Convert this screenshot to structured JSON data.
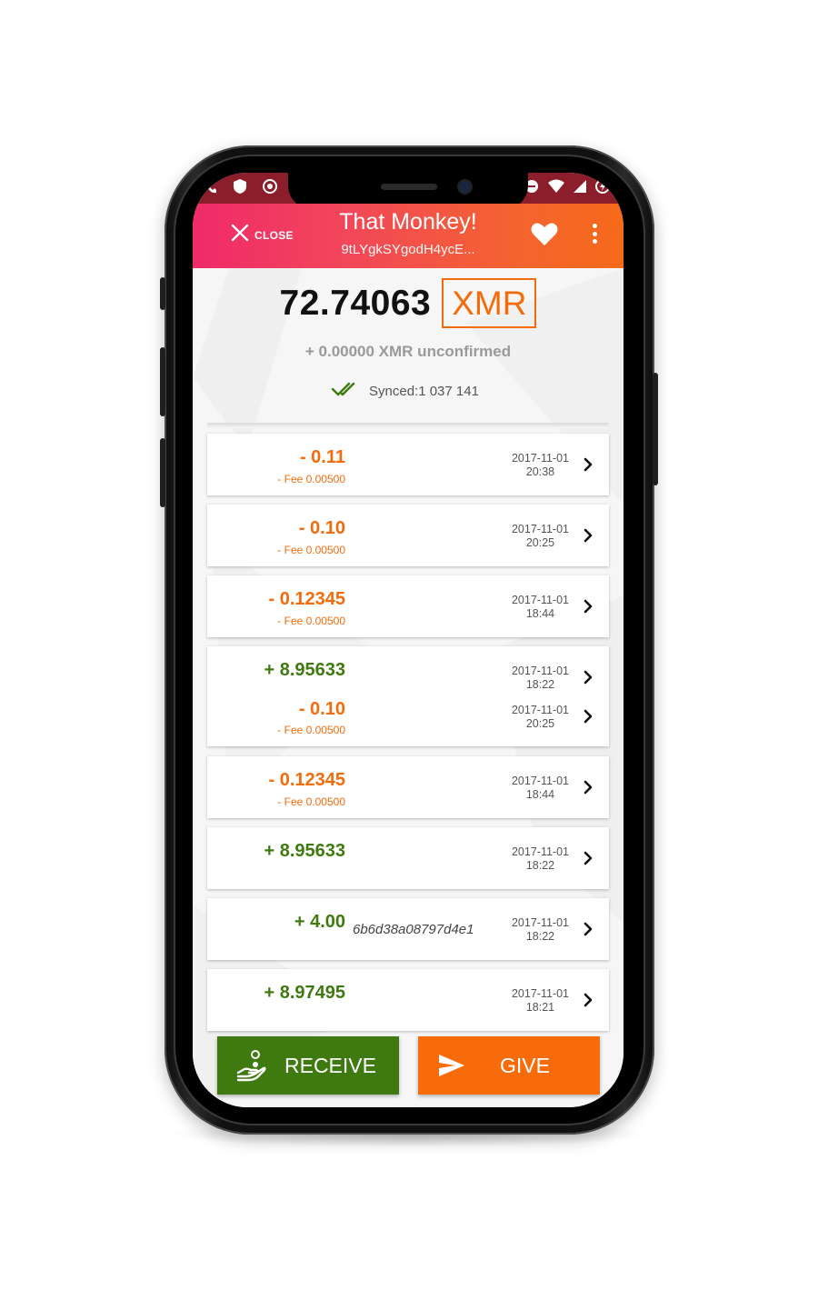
{
  "status_bar": {
    "left_icons": [
      "phone-signal-icon",
      "shield-icon",
      "target-icon"
    ],
    "right_icons": [
      "data-saver-icon",
      "wifi-icon",
      "cell-signal-icon",
      "battery-charging-icon"
    ]
  },
  "header": {
    "close_label": "CLOSE",
    "wallet_name": "That Monkey!",
    "wallet_address": "9tLYgkSYgodH4ycE...",
    "colors": {
      "gradient_start": "#ef2a6a",
      "gradient_end": "#f66a1a"
    }
  },
  "balance": {
    "amount": "72.74063",
    "currency": "XMR",
    "unconfirmed": "+ 0.00000 XMR unconfirmed",
    "synced": "Synced:1 037 141"
  },
  "transactions": [
    {
      "amount": "- 0.11",
      "fee": "- Fee 0.00500",
      "date": "2017-11-01",
      "time": "20:38",
      "direction": "out"
    },
    {
      "amount": "- 0.10",
      "fee": "- Fee 0.00500",
      "date": "2017-11-01",
      "time": "20:25",
      "direction": "out"
    },
    {
      "amount": "- 0.12345",
      "fee": "- Fee 0.00500",
      "date": "2017-11-01",
      "time": "18:44",
      "direction": "out"
    },
    {
      "amount": "+ 8.95633",
      "date": "2017-11-01",
      "time": "18:22",
      "direction": "in"
    },
    {
      "amount": "- 0.10",
      "fee": "- Fee 0.00500",
      "date": "2017-11-01",
      "time": "20:25",
      "direction": "out"
    },
    {
      "amount": "- 0.12345",
      "fee": "- Fee 0.00500",
      "date": "2017-11-01",
      "time": "18:44",
      "direction": "out"
    },
    {
      "amount": "+ 8.95633",
      "date": "2017-11-01",
      "time": "18:22",
      "direction": "in"
    },
    {
      "amount": "+ 4.00",
      "payment_id": "6b6d38a08797d4e1",
      "date": "2017-11-01",
      "time": "18:22",
      "direction": "in"
    },
    {
      "amount": "+ 8.97495",
      "date": "2017-11-01",
      "time": "18:21",
      "direction": "in"
    }
  ],
  "actions": {
    "receive_label": "RECEIVE",
    "give_label": "GIVE",
    "receive_color": "#3f7a10",
    "give_color": "#f86b0a"
  }
}
